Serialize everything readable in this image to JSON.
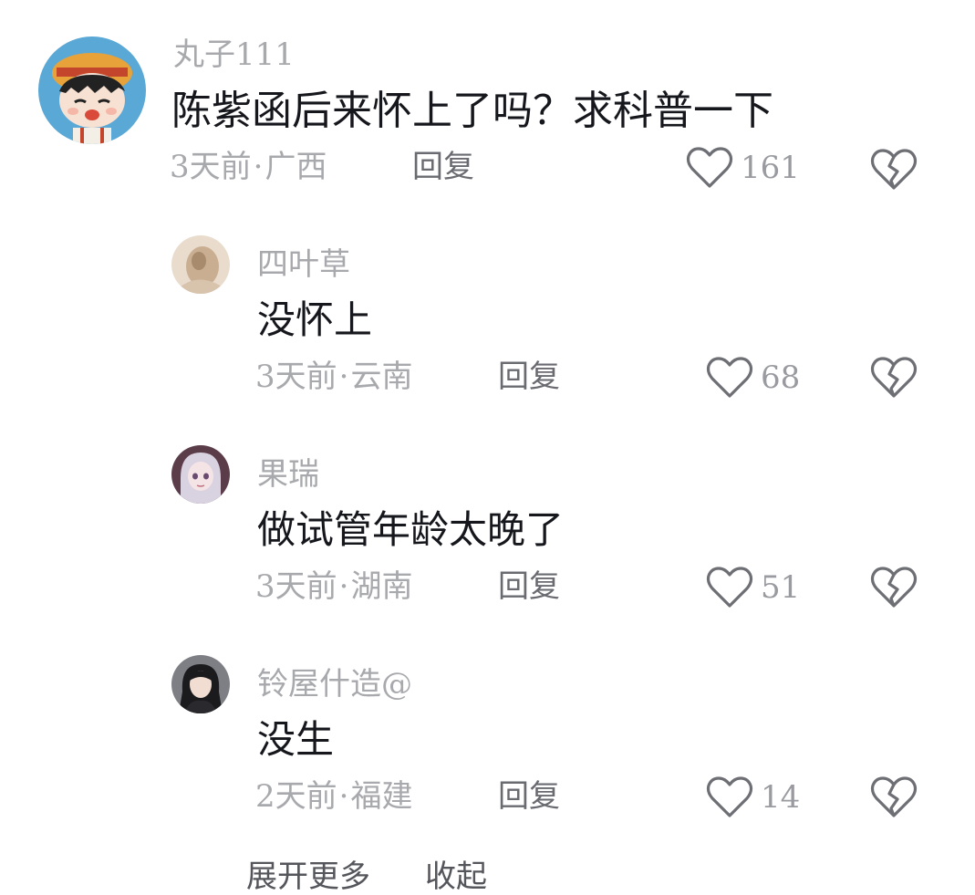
{
  "comments": [
    {
      "username": "丸子111",
      "text": "陈紫函后来怀上了吗？求科普一下",
      "time": "3天前",
      "location": "广西",
      "reply_label": "回复",
      "likes": "161"
    }
  ],
  "replies": [
    {
      "username": "四叶草",
      "text": "没怀上",
      "time": "3天前",
      "location": "云南",
      "reply_label": "回复",
      "likes": "68"
    },
    {
      "username": "果瑞",
      "text": "做试管年龄太晚了",
      "time": "3天前",
      "location": "湖南",
      "reply_label": "回复",
      "likes": "51"
    },
    {
      "username": "铃屋什造@",
      "text": "没生",
      "time": "2天前",
      "location": "福建",
      "reply_label": "回复",
      "likes": "14"
    }
  ],
  "separator": "·",
  "footer": {
    "expand_label": "展开更多",
    "collapse_label": "收起"
  },
  "icons": {
    "like": "heart-outline-icon",
    "dislike": "broken-heart-icon"
  },
  "colors": {
    "username": "#a8a9ad",
    "text": "#16171c",
    "icon": "#6e6f74"
  }
}
